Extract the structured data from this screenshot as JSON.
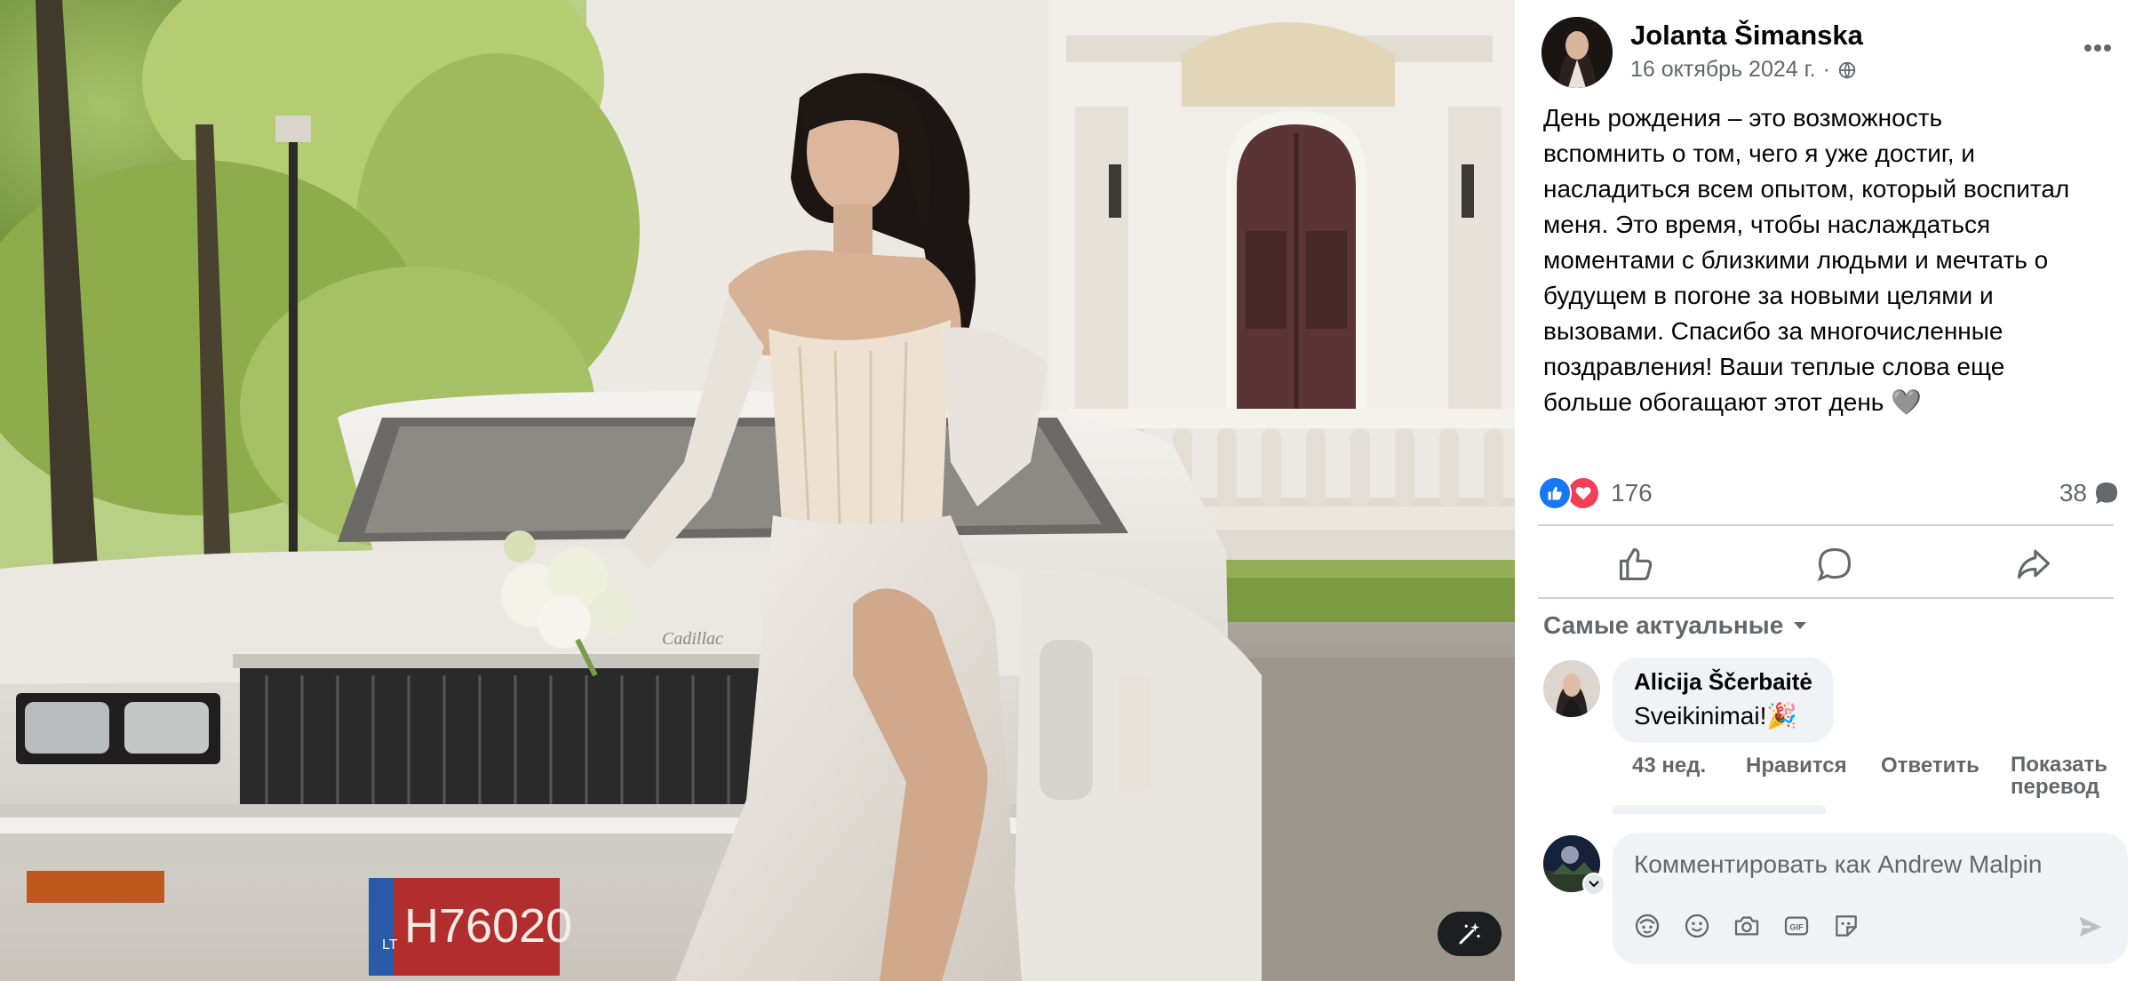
{
  "post": {
    "author": "Jolanta Šimanska",
    "date": "16 октябрь 2024 г.",
    "separator": "·",
    "text": "День рождения – это возможность\nвспомнить о том, чего я уже достиг, и\nнасладиться всем опытом, который воспитал\nменя. Это время, чтобы наслаждаться\nмоментами с близкими людьми и мечтать о\nбудущем в погоне за новыми целями и\nвызовами. Спасибо за многочисленные\nпоздравления! Ваши теплые слова еще\nбольше обогащают этот день 🩶"
  },
  "stats": {
    "reactions_count": "176",
    "comments_count": "38"
  },
  "comments": {
    "sort_label": "Самые актуальные",
    "items": [
      {
        "author": "Alicija Ščerbaitė",
        "text": "Sveikinimai!🎉",
        "time": "43 нед.",
        "like_label": "Нравится",
        "reply_label": "Ответить",
        "translate_label": "Показать\nперевод"
      }
    ]
  },
  "composer": {
    "placeholder": "Комментировать как Andrew Malpin"
  },
  "photo": {
    "plate_text": "H76020",
    "plate_country": "LT",
    "emblem_text": "Cadillac"
  },
  "colors": {
    "like_blue": "#1877f2",
    "love_red": "#f33e58",
    "secondary_text": "#65676b",
    "bubble_bg": "#f0f2f5"
  },
  "icons": [
    "globe-icon",
    "more-icon",
    "like-icon",
    "love-icon",
    "comment-bubble-icon",
    "share-icon",
    "caret-down-icon",
    "avatar-icon",
    "sticker-icon",
    "emoji-icon",
    "camera-icon",
    "gif-icon",
    "send-icon",
    "magic-wand-icon"
  ]
}
